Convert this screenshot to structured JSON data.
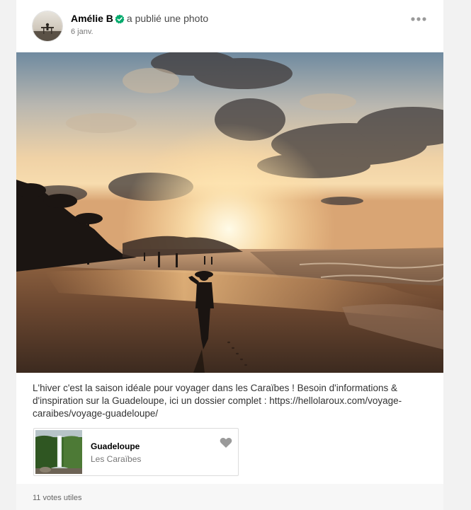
{
  "post": {
    "author": "Amélie B",
    "action": "a publié une photo",
    "date": "6 janv.",
    "caption": "L'hiver c'est la saison idéale pour voyager dans les Caraïbes ! Besoin d'informations & d'inspiration sur la Guadeloupe, ici un dossier complet : https://hellolaroux.com/voyage-caraibes/voyage-guadeloupe/",
    "photo_icon": "sunset-beach-photo",
    "verified_icon": "verified-check-icon",
    "more_icon": "ellipsis-icon"
  },
  "place": {
    "name": "Guadeloupe",
    "region": "Les Caraïbes",
    "thumb_icon": "waterfall-thumbnail",
    "save_icon": "heart-icon"
  },
  "footer": {
    "votes": "11 votes utiles"
  },
  "colors": {
    "verified": "#00aa6c",
    "icon_gray": "#9a9a9a",
    "footer_bg": "#f7f7f7"
  }
}
